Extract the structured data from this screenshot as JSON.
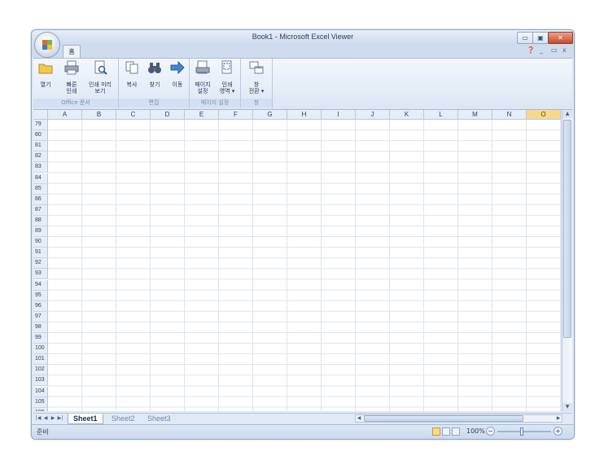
{
  "window": {
    "title": "Book1 - Microsoft Excel Viewer"
  },
  "window_controls": {
    "minimize": "▭",
    "maximize": "▣",
    "close": "✕"
  },
  "tabs": [
    {
      "label": "홈"
    }
  ],
  "tab_right": {
    "help": "❓",
    "min": "_",
    "restore": "▭",
    "close": "x"
  },
  "ribbon": {
    "groups": [
      {
        "label": "Office 문서",
        "buttons": [
          {
            "label": "열기",
            "icon": "folder-icon"
          },
          {
            "label": "빠른\n인쇄",
            "icon": "printer-icon"
          },
          {
            "label": "인쇄 미리\n보기",
            "icon": "print-preview-icon"
          }
        ]
      },
      {
        "label": "편집",
        "buttons": [
          {
            "label": "복사",
            "icon": "copy-icon"
          },
          {
            "label": "찾기",
            "icon": "binoculars-icon"
          },
          {
            "label": "이동",
            "icon": "arrow-right-icon"
          }
        ]
      },
      {
        "label": "페이지 설정",
        "buttons": [
          {
            "label": "페이지\n설정",
            "icon": "page-setup-icon"
          },
          {
            "label": "인쇄\n영역 ▾",
            "icon": "print-area-icon"
          }
        ]
      },
      {
        "label": "창",
        "buttons": [
          {
            "label": "창\n전환 ▾",
            "icon": "switch-window-icon"
          }
        ]
      }
    ]
  },
  "sheet": {
    "columns": [
      "A",
      "B",
      "C",
      "D",
      "E",
      "F",
      "G",
      "H",
      "I",
      "J",
      "K",
      "L",
      "M",
      "N",
      "O"
    ],
    "selected_column": "O",
    "rows": [
      "79",
      "80",
      "81",
      "82",
      "83",
      "84",
      "85",
      "86",
      "87",
      "88",
      "89",
      "90",
      "91",
      "92",
      "93",
      "94",
      "95",
      "96",
      "97",
      "98",
      "99",
      "100",
      "101",
      "102",
      "103",
      "104",
      "105",
      "106"
    ]
  },
  "sheet_tabs": [
    {
      "label": "Sheet1",
      "active": true
    },
    {
      "label": "Sheet2",
      "active": false
    },
    {
      "label": "Sheet3",
      "active": false
    }
  ],
  "sheet_nav": [
    "|◀",
    "◀",
    "▶",
    "▶|"
  ],
  "status": {
    "text": "준비",
    "zoom": "100%",
    "zoom_minus": "−",
    "zoom_plus": "+"
  },
  "colors": {
    "accent": "#f8d98c",
    "frame": "#8ea6c7",
    "ribbon": "#dbe6f4"
  }
}
